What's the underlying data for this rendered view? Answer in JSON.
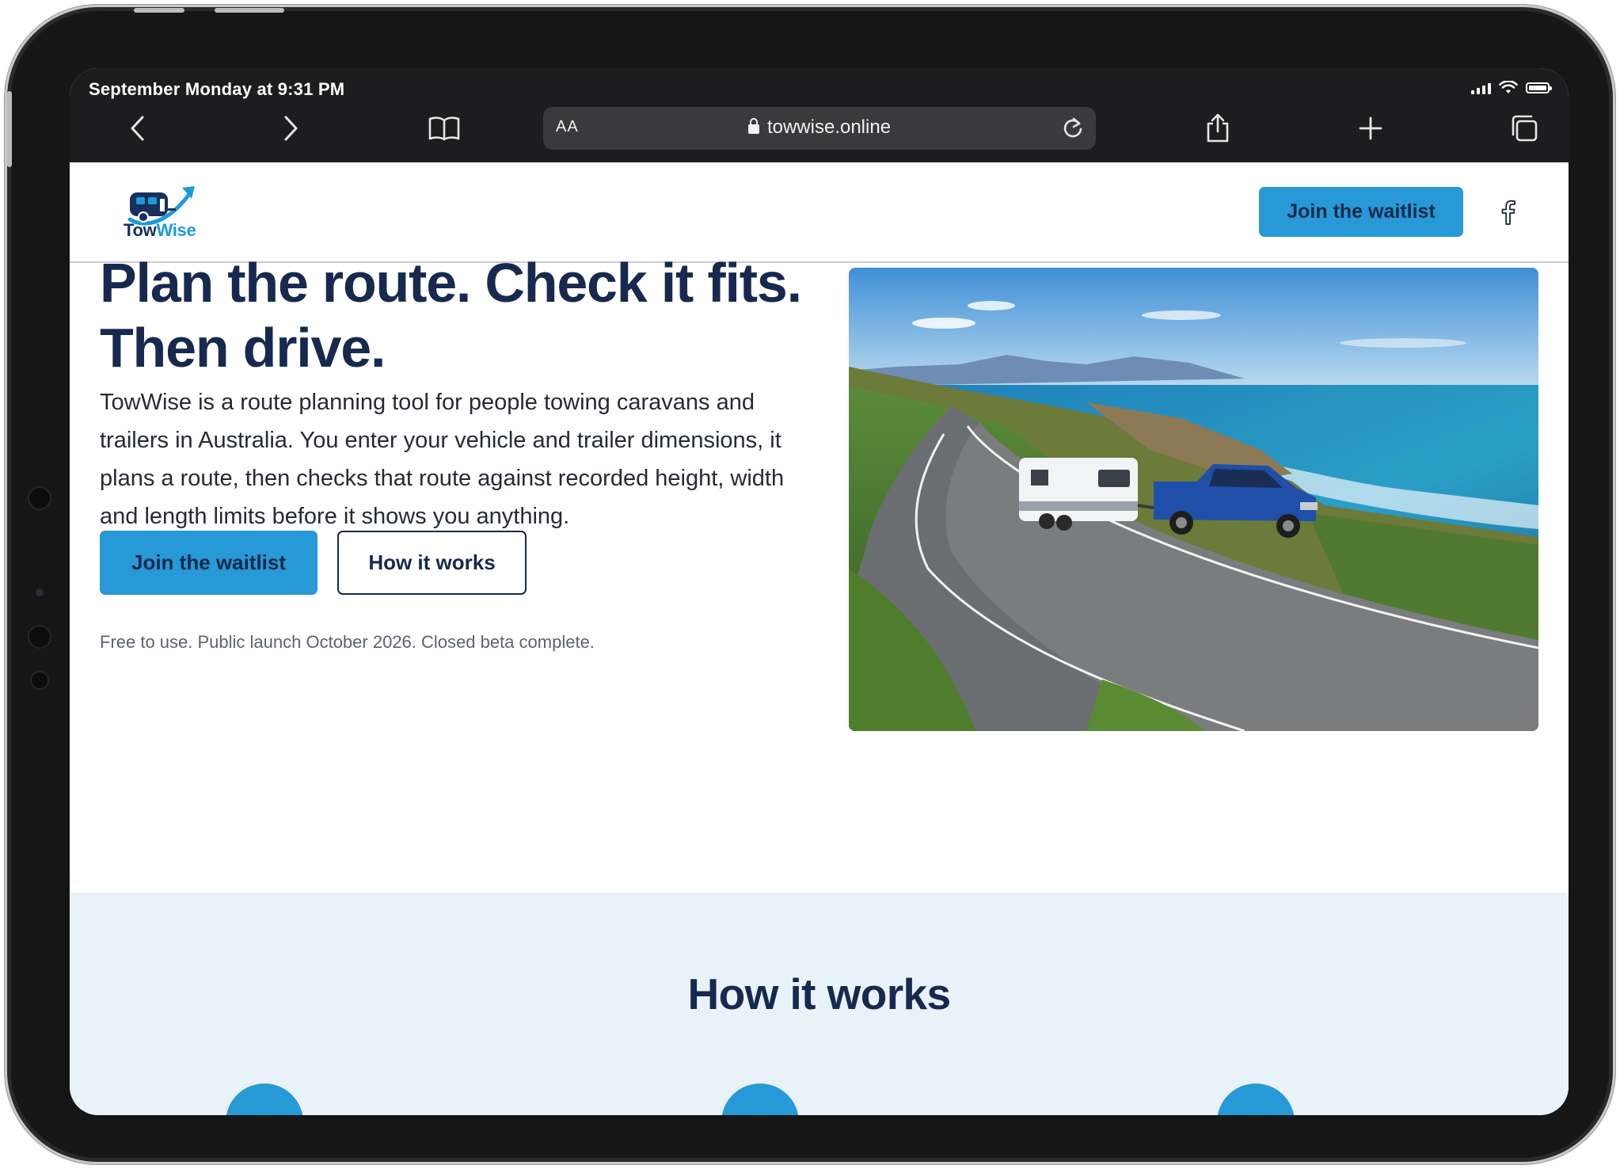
{
  "status_bar": {
    "time": "September Monday at 9:31 PM"
  },
  "browser": {
    "aa_label": "AA",
    "url": "towwise.online",
    "icons": [
      "back-icon",
      "forward-icon",
      "bookmarks-icon",
      "lock-icon",
      "reload-icon",
      "share-icon",
      "new-tab-icon",
      "tabs-icon"
    ]
  },
  "site_header": {
    "logo_text_a": "Tow",
    "logo_text_b": "Wise",
    "cta_label": "Join the waitlist",
    "social_icon": "facebook-icon"
  },
  "hero": {
    "title_line1": "Plan the route. Check it fits.",
    "title_line2": "Then drive.",
    "description": "TowWise is a route planning tool for people towing caravans and trailers in Australia. You enter your vehicle and trailer dimensions, it plans a route, then checks that route against recorded height, width and length limits before it shows you anything.",
    "primary_cta": "Join the waitlist",
    "secondary_cta": "How it works",
    "note": "Free to use. Public launch October 2026. Closed beta complete."
  },
  "how_it_works": {
    "title": "How it works",
    "step_count": 3
  },
  "colors": {
    "brand_blue": "#2799d6",
    "navy": "#17294f",
    "section_bg": "#e9f2f9",
    "chrome_bg": "#1d1d1f"
  }
}
